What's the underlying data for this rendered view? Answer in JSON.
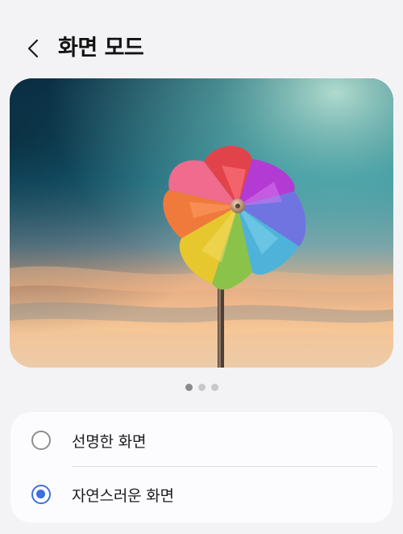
{
  "header": {
    "title": "화면 모드",
    "back_icon": "chevron-left-icon"
  },
  "preview": {
    "image": "colorful pinwheel against a sunset sky",
    "page_count": 3,
    "active_page": 1
  },
  "options": [
    {
      "label": "선명한 화면",
      "selected": false
    },
    {
      "label": "자연스러운 화면",
      "selected": true
    }
  ],
  "colors": {
    "accent": "#3d6fe0",
    "background": "#f3f3f6",
    "card": "#fcfcfe"
  }
}
